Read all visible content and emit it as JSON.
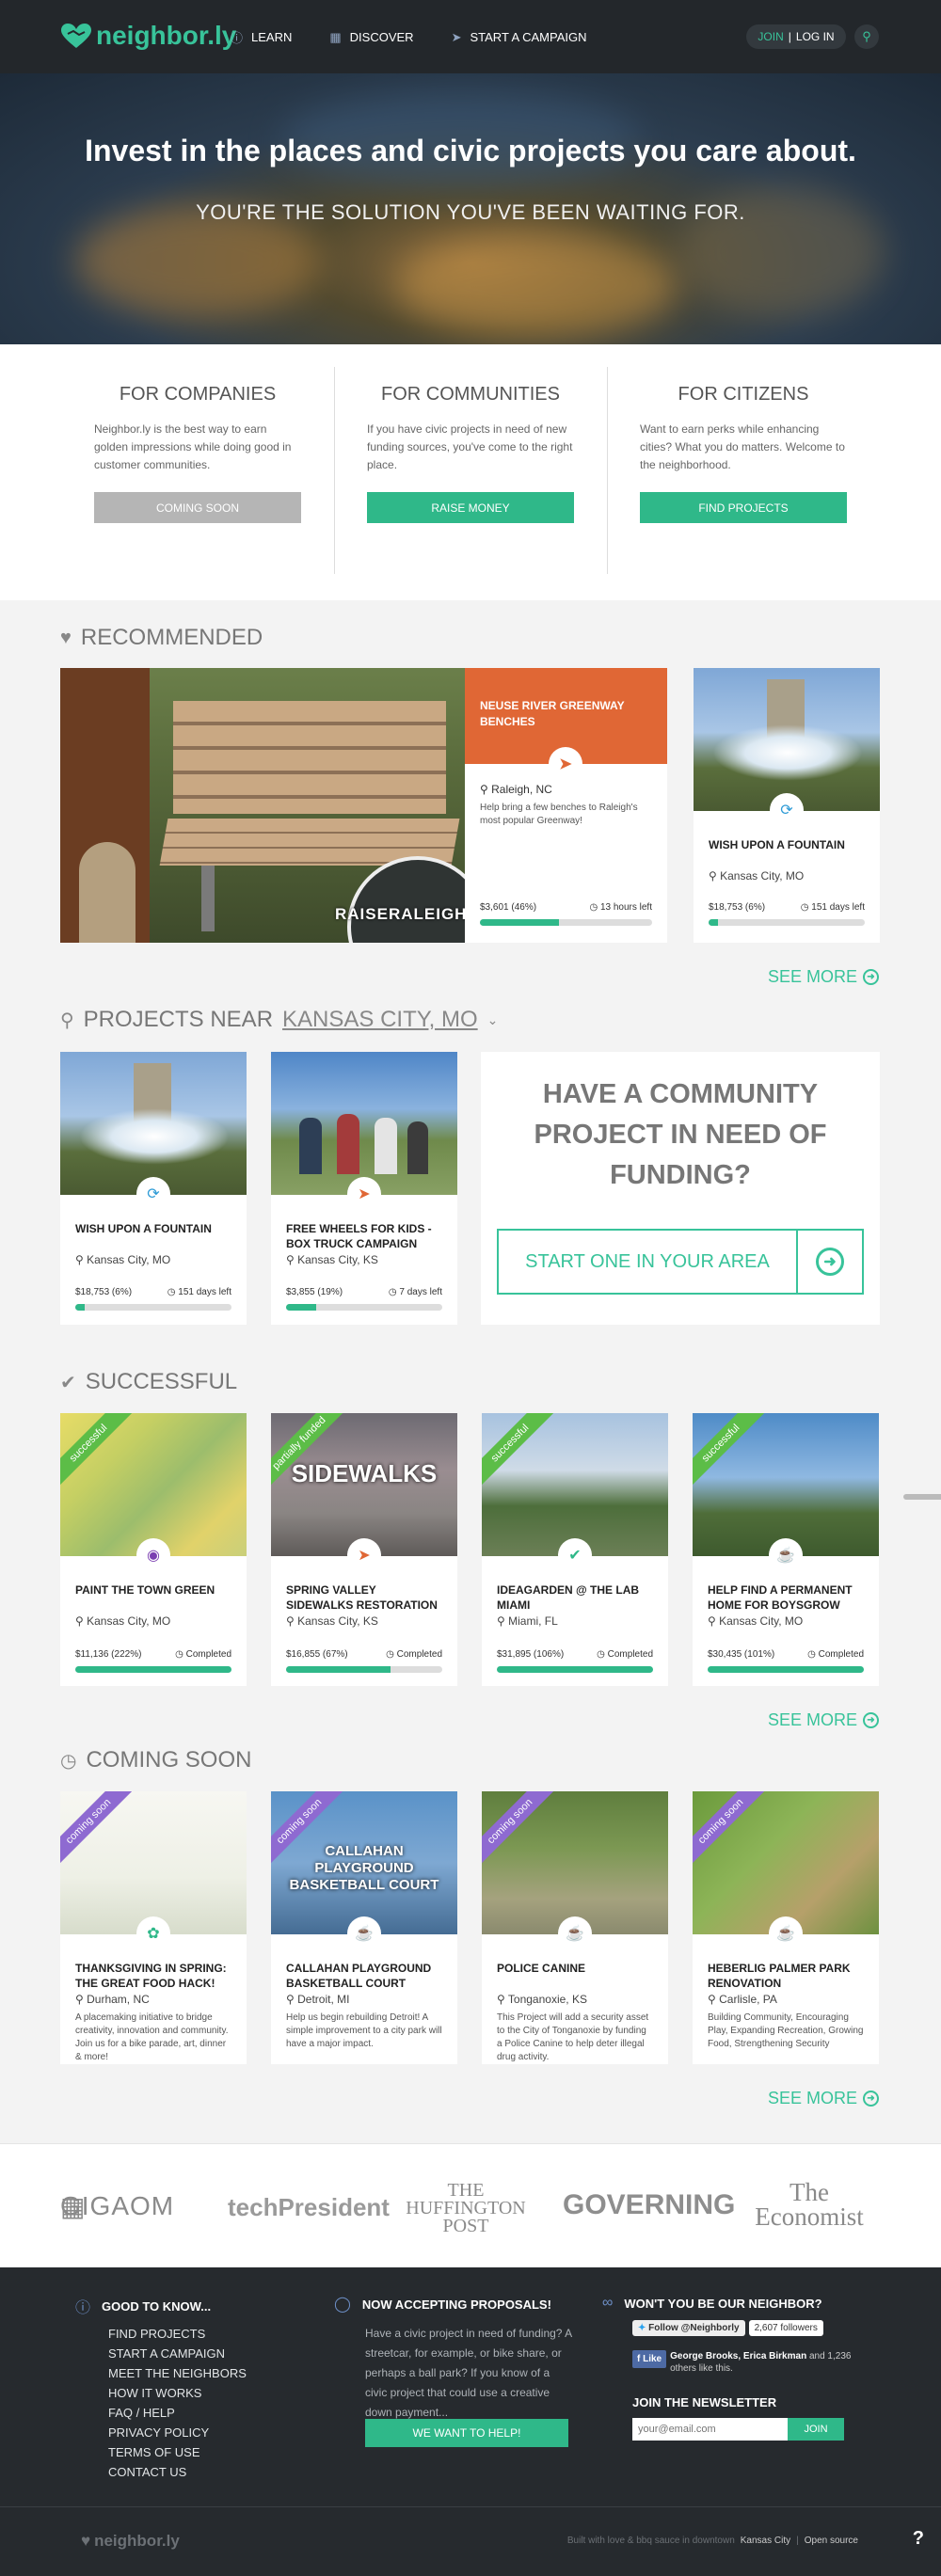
{
  "header": {
    "logo_text": "neighbor.ly",
    "nav": [
      {
        "icon": "info-icon",
        "label": "LEARN"
      },
      {
        "icon": "grid-icon",
        "label": "DISCOVER"
      },
      {
        "icon": "rocket-icon",
        "label": "START A CAMPAIGN"
      }
    ],
    "join_label": "JOIN",
    "separator": "|",
    "login_label": "LOG IN"
  },
  "hero": {
    "headline": "Invest in the places and civic projects you care about.",
    "subheadline": "YOU'RE THE SOLUTION YOU'VE BEEN WAITING FOR."
  },
  "audiences": [
    {
      "title": "FOR COMPANIES",
      "text": "Neighbor.ly is the best way to earn golden impressions while doing good in customer communities.",
      "button": "COMING SOON",
      "button_color": "#b5b5b5"
    },
    {
      "title": "FOR COMMUNITIES",
      "text": "If you have civic projects in need of new funding sources, you've come to the right place.",
      "button": "RAISE MONEY",
      "button_color": "#2fb889"
    },
    {
      "title": "FOR CITIZENS",
      "text": "Want to earn perks while enhancing cities? What you do matters. Welcome to the neighborhood.",
      "button": "FIND PROJECTS",
      "button_color": "#2fb889"
    }
  ],
  "recommended": {
    "heading": "RECOMMENDED",
    "featured_watermark": "RAISERALEIGH",
    "featured": {
      "title": "NEUSE RIVER GREENWAY BENCHES",
      "location": "Raleigh, NC",
      "desc": "Help bring a few benches to Raleigh's most popular Greenway!",
      "amount": "$3,601 (46%)",
      "time": "13 hours left",
      "progress": 0.46
    },
    "side": {
      "title": "WISH UPON A FOUNTAIN",
      "location": "Kansas City, MO",
      "amount": "$18,753 (6%)",
      "time": "151 days left",
      "progress": 0.06
    },
    "see_more": "SEE MORE"
  },
  "near": {
    "heading_prefix": "PROJECTS NEAR",
    "location": "KANSAS CITY, MO",
    "cards": [
      {
        "title": "WISH UPON A FOUNTAIN",
        "location": "Kansas City, MO",
        "amount": "$18,753 (6%)",
        "time": "151 days left",
        "progress": 0.06
      },
      {
        "title": "FREE WHEELS FOR KIDS - BOX TRUCK CAMPAIGN",
        "location": "Kansas City, KS",
        "amount": "$3,855 (19%)",
        "time": "7 days left",
        "progress": 0.19
      }
    ],
    "cta_heading": "HAVE A COMMUNITY PROJECT IN NEED OF FUNDING?",
    "cta_button": "START ONE IN YOUR AREA"
  },
  "successful": {
    "heading": "SUCCESSFUL",
    "cards": [
      {
        "ribbon": "successful",
        "title": "PAINT THE TOWN GREEN",
        "location": "Kansas City, MO",
        "amount": "$11,136 (222%)",
        "status": "Completed",
        "progress": 1.0
      },
      {
        "ribbon": "partially funded",
        "img_text": "SIDEWALKS",
        "title": "SPRING VALLEY SIDEWALKS RESTORATION",
        "location": "Kansas City, KS",
        "amount": "$16,855 (67%)",
        "status": "Completed",
        "progress": 0.67
      },
      {
        "ribbon": "successful",
        "title": "IDEAGARDEN @ THE LAB MIAMI",
        "location": "Miami, FL",
        "amount": "$31,895 (106%)",
        "status": "Completed",
        "progress": 1.0
      },
      {
        "ribbon": "successful",
        "title": "HELP FIND A PERMANENT HOME FOR BOYSGROW",
        "location": "Kansas City, MO",
        "amount": "$30,435 (101%)",
        "status": "Completed",
        "progress": 1.0
      }
    ],
    "see_more": "SEE MORE"
  },
  "coming_soon": {
    "heading": "COMING SOON",
    "cards": [
      {
        "ribbon": "coming soon",
        "title": "THANKSGIVING IN SPRING: THE GREAT FOOD HACK!",
        "location": "Durham, NC",
        "desc": "A placemaking initiative to bridge creativity, innovation and community. Join us for a bike parade, art, dinner & more!"
      },
      {
        "ribbon": "coming soon",
        "img_text": "CALLAHAN PLAYGROUND BASKETBALL COURT",
        "title": "CALLAHAN PLAYGROUND BASKETBALL COURT",
        "location": "Detroit, MI",
        "desc": "Help us begin rebuilding Detroit! A simple improvement to a city park will have a major impact."
      },
      {
        "ribbon": "coming soon",
        "title": "POLICE CANINE",
        "location": "Tonganoxie, KS",
        "desc": "This Project will add a security asset to the City of Tonganoxie by funding a Police Canine to help deter illegal drug activity."
      },
      {
        "ribbon": "coming soon",
        "title": "HEBERLIG PALMER PARK RENOVATION",
        "location": "Carlisle, PA",
        "desc": "Building Community, Encouraging Play, Expanding Recreation, Growing Food, Strengthening Security"
      }
    ],
    "see_more": "SEE MORE"
  },
  "press": [
    "GIGAOM",
    "techPresident",
    "THE HUFFINGTON POST",
    "GOVERNING",
    "The Economist"
  ],
  "footer": {
    "col1_heading": "GOOD TO KNOW...",
    "links": [
      "FIND PROJECTS",
      "START A CAMPAIGN",
      "MEET THE NEIGHBORS",
      "HOW IT WORKS",
      "FAQ / HELP",
      "PRIVACY POLICY",
      "TERMS OF USE",
      "CONTACT US"
    ],
    "col2_heading": "NOW ACCEPTING PROPOSALS!",
    "col2_text": "Have a civic project in need of funding? A streetcar, for example, or bike share, or perhaps a ball park? If you know of a civic project that could use a creative down payment...",
    "col2_button": "WE WANT TO HELP!",
    "col3_heading": "WON'T YOU BE OUR NEIGHBOR?",
    "twitter_label": "Follow @Neighborly",
    "twitter_count": "2,607 followers",
    "fb_like": "Like",
    "fb_text_names": "George Brooks, Erica Birkman",
    "fb_text_rest": "and 1,236 others like this.",
    "newsletter_heading": "JOIN THE NEWSLETTER",
    "email_placeholder": "your@email.com",
    "newsletter_button": "JOIN",
    "bottom_logo": "neighbor.ly",
    "built_with": "Built with love & bbq sauce in downtown",
    "built_city": "Kansas City",
    "bottom_sep": "|",
    "open_source": "Open source",
    "help_glyph": "?"
  }
}
